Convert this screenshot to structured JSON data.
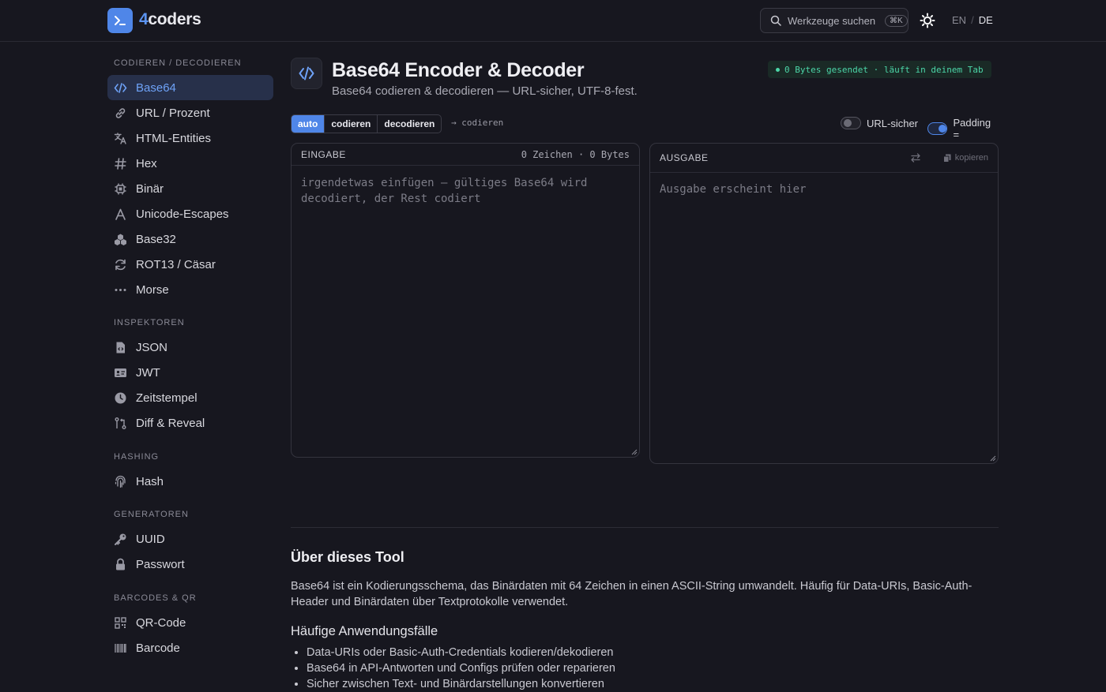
{
  "header": {
    "brand_prefix": "4",
    "brand_suffix": "coders",
    "search_placeholder": "Werkzeuge suchen",
    "search_shortcut": "⌘K",
    "lang_en": "EN",
    "lang_sep": "/",
    "lang_de": "DE"
  },
  "sidebar": {
    "sections": [
      {
        "title": "CODIEREN / DECODIEREN",
        "items": [
          {
            "label": "Base64",
            "icon": "code-icon",
            "active": true
          },
          {
            "label": "URL / Prozent",
            "icon": "link-icon"
          },
          {
            "label": "HTML-Entities",
            "icon": "translate-icon"
          },
          {
            "label": "Hex",
            "icon": "hash-icon"
          },
          {
            "label": "Binär",
            "icon": "chip-icon"
          },
          {
            "label": "Unicode-Escapes",
            "icon": "font-icon"
          },
          {
            "label": "Base32",
            "icon": "cubes-icon"
          },
          {
            "label": "ROT13 / Cäsar",
            "icon": "refresh-icon"
          },
          {
            "label": "Morse",
            "icon": "dots-icon"
          }
        ]
      },
      {
        "title": "INSPEKTOREN",
        "items": [
          {
            "label": "JSON",
            "icon": "file-code-icon"
          },
          {
            "label": "JWT",
            "icon": "id-card-icon"
          },
          {
            "label": "Zeitstempel",
            "icon": "clock-icon"
          },
          {
            "label": "Diff & Reveal",
            "icon": "git-compare-icon"
          }
        ]
      },
      {
        "title": "HASHING",
        "items": [
          {
            "label": "Hash",
            "icon": "fingerprint-icon"
          }
        ]
      },
      {
        "title": "GENERATOREN",
        "items": [
          {
            "label": "UUID",
            "icon": "key-icon"
          },
          {
            "label": "Passwort",
            "icon": "lock-icon"
          }
        ]
      },
      {
        "title": "BARCODES & QR",
        "items": [
          {
            "label": "QR-Code",
            "icon": "qr-icon"
          },
          {
            "label": "Barcode",
            "icon": "barcode-icon"
          }
        ]
      }
    ]
  },
  "tool": {
    "title": "Base64 Encoder & Decoder",
    "subtitle": "Base64 codieren & decodieren — URL-sicher, UTF-8-fest.",
    "status": "0 Bytes gesendet · läuft in deinem Tab",
    "modes": [
      "auto",
      "codieren",
      "decodieren"
    ],
    "active_mode": "auto",
    "mode_hint": "→ codieren",
    "toggles": [
      {
        "label": "URL-sicher",
        "on": false
      },
      {
        "label": "Padding =",
        "on": true
      }
    ],
    "input": {
      "label": "EINGABE",
      "counter": "0 Zeichen · 0 Bytes",
      "placeholder_line1": "irgendetwas einfügen — gültiges Base64 wird",
      "placeholder_line2": "decodiert, der Rest codiert"
    },
    "output": {
      "label": "AUSGABE",
      "copy_label": "kopieren",
      "placeholder": "Ausgabe erscheint hier"
    }
  },
  "about": {
    "heading": "Über dieses Tool",
    "text": "Base64 ist ein Kodierungsschema, das Binärdaten mit 64 Zeichen in einen ASCII-String umwandelt. Häufig für Data-URIs, Basic-Auth-Header und Binärdaten über Textprotokolle verwendet.",
    "uses_heading": "Häufige Anwendungsfälle",
    "uses": [
      "Data-URIs oder Basic-Auth-Credentials kodieren/dekodieren",
      "Base64 in API-Antworten und Configs prüfen oder reparieren",
      "Sicher zwischen Text- und Binärdarstellungen konvertieren"
    ]
  },
  "colors": {
    "accent": "#4f86e8",
    "background": "#17171f",
    "status_green": "#4cd6a8"
  }
}
